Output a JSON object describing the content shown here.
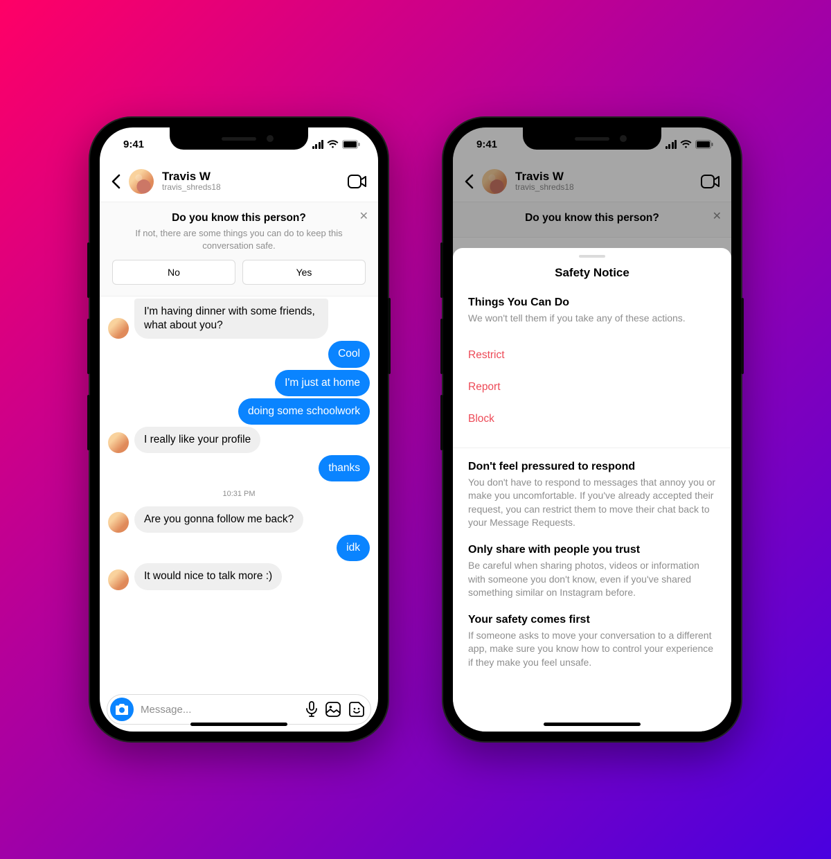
{
  "status": {
    "time": "9:41"
  },
  "header": {
    "name": "Travis W",
    "handle": "travis_shreds18"
  },
  "banner": {
    "title": "Do you know this person?",
    "sub": "If not, there are some things you can do to keep this conversation safe.",
    "no": "No",
    "yes": "Yes"
  },
  "messages": {
    "m1": "I'm having dinner with some friends, what about you?",
    "m2": "Cool",
    "m3": "I'm just at home",
    "m4": "doing some schoolwork",
    "m5": "I really like your profile",
    "m6": "thanks",
    "ts": "10:31 PM",
    "m7": "Are you gonna follow me back?",
    "m8": "idk",
    "m9": "It would nice to talk more :)"
  },
  "composer": {
    "placeholder": "Message..."
  },
  "sheet": {
    "title": "Safety Notice",
    "section_h": "Things You Can Do",
    "section_p": "We won't tell them if you take any of these actions.",
    "actions": {
      "restrict": "Restrict",
      "report": "Report",
      "block": "Block"
    },
    "tips": {
      "t1h": "Don't feel pressured to respond",
      "t1p": "You don't have to respond to messages that annoy you or make you uncomfortable. If you've already accepted their request, you can restrict them to move their chat back to your Message Requests.",
      "t2h": "Only share with people you trust",
      "t2p": "Be careful when sharing photos, videos or information with someone you don't know, even if you've shared something similar on Instagram before.",
      "t3h": "Your safety comes first",
      "t3p": "If someone asks to move your conversation to a different app, make sure you know how to control your experience if they make you feel unsafe."
    }
  }
}
